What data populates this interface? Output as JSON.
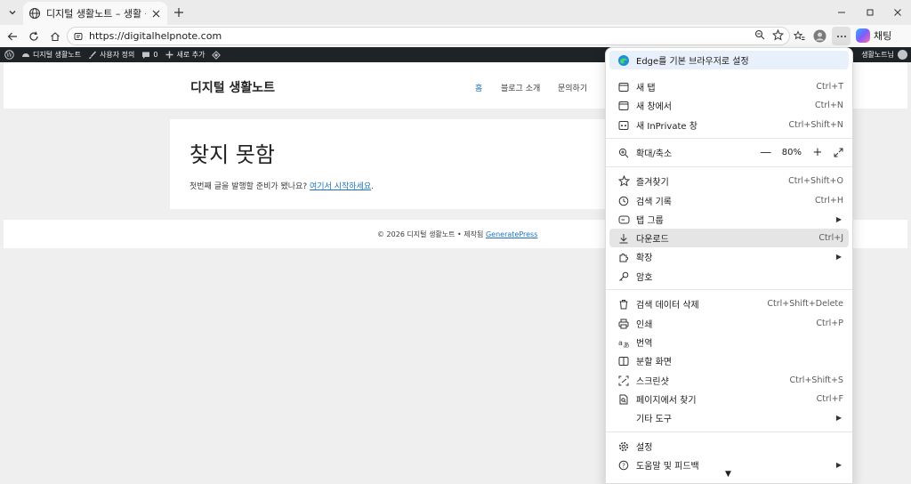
{
  "tab": {
    "title": "디지털 생활노트 – 생활 속 디지털"
  },
  "address": {
    "url": "https://digitalhelpnote.com"
  },
  "copilot": {
    "label": "채팅"
  },
  "wpbar": {
    "site": "디지털 생활노트",
    "customize": "사용자 정의",
    "comments": "0",
    "new": "새로 추가",
    "howdy": "생활노트님"
  },
  "site": {
    "title": "디지털 생활노트",
    "nav": [
      "홈",
      "블로그 소개",
      "문의하기"
    ],
    "heading": "찾지 못함",
    "body_prefix": "첫번째 글을 발행할 준비가 됐나요?",
    "body_link": "여기서 시작하세요",
    "body_suffix": ".",
    "footer_prefix": "© 2026 디지털 생활노트 • 제작됨",
    "footer_link": "GeneratePress"
  },
  "menu": {
    "promo": "Edge를 기본 브라우저로 설정",
    "items": [
      {
        "label": "새 탭",
        "shortcut": "Ctrl+T",
        "icon": "new-tab-icon"
      },
      {
        "label": "새 창에서",
        "shortcut": "Ctrl+N",
        "icon": "new-window-icon"
      },
      {
        "label": "새 InPrivate 창",
        "shortcut": "Ctrl+Shift+N",
        "icon": "inprivate-icon"
      },
      {
        "label": "확대/축소",
        "shortcut": "",
        "icon": "zoom-icon"
      },
      {
        "label": "즐겨찾기",
        "shortcut": "Ctrl+Shift+O",
        "icon": "favorites-icon"
      },
      {
        "label": "검색 기록",
        "shortcut": "Ctrl+H",
        "icon": "history-icon"
      },
      {
        "label": "탭 그룹",
        "shortcut": "",
        "icon": "tab-groups-icon"
      },
      {
        "label": "다운로드",
        "shortcut": "Ctrl+J",
        "icon": "download-icon"
      },
      {
        "label": "확장",
        "shortcut": "",
        "icon": "extensions-icon"
      },
      {
        "label": "암호",
        "shortcut": "",
        "icon": "key-icon"
      },
      {
        "label": "검색 데이터 삭제",
        "shortcut": "Ctrl+Shift+Delete",
        "icon": "trash-icon"
      },
      {
        "label": "인쇄",
        "shortcut": "Ctrl+P",
        "icon": "print-icon"
      },
      {
        "label": "번역",
        "shortcut": "",
        "icon": "translate-icon"
      },
      {
        "label": "분할 화면",
        "shortcut": "",
        "icon": "split-screen-icon"
      },
      {
        "label": "스크린샷",
        "shortcut": "Ctrl+Shift+S",
        "icon": "screenshot-icon"
      },
      {
        "label": "페이지에서 찾기",
        "shortcut": "Ctrl+F",
        "icon": "find-icon"
      },
      {
        "label": "기타 도구",
        "shortcut": "",
        "icon": ""
      },
      {
        "label": "설정",
        "shortcut": "",
        "icon": "gear-icon"
      },
      {
        "label": "도움말 및 피드백",
        "shortcut": "",
        "icon": "help-icon"
      }
    ],
    "zoom": {
      "value": "80%",
      "minus": "—",
      "plus": "+"
    }
  }
}
